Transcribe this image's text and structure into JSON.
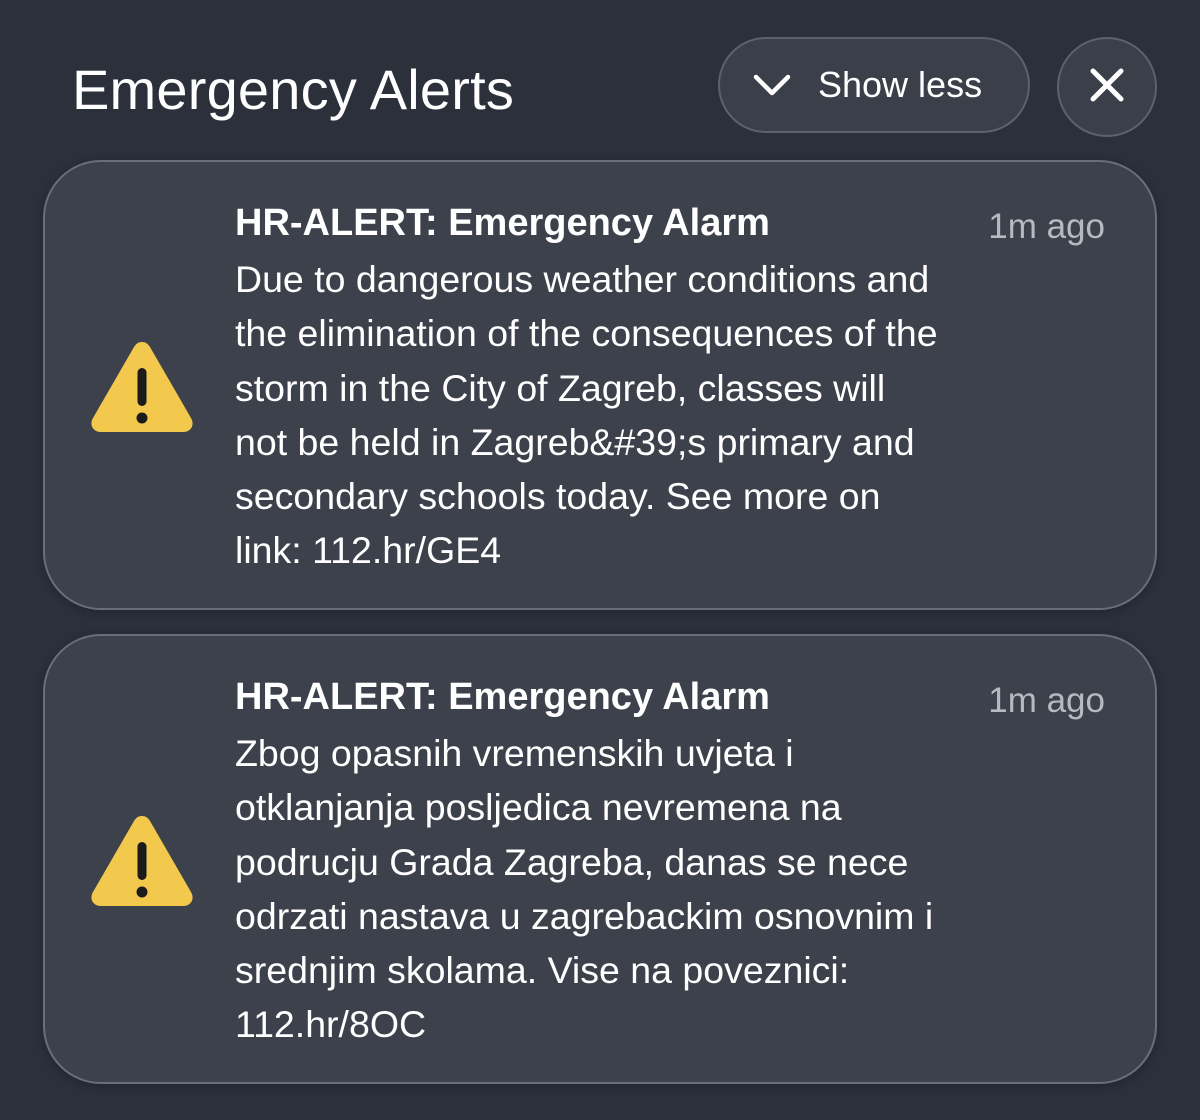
{
  "header": {
    "title": "Emergency Alerts",
    "show_less_label": "Show less",
    "show_less_icon": "chevron-down-icon",
    "close_icon": "close-icon"
  },
  "colors": {
    "background": "#2c303b",
    "card": "#3d414b",
    "warning_yellow": "#f2c94c",
    "timestamp": "#b7bac1"
  },
  "alerts": [
    {
      "icon": "warning-icon",
      "title": "HR-ALERT: Emergency Alarm",
      "time": "1m ago",
      "lines": [
        "Due to dangerous weather conditions and",
        "the elimination of the consequences of the",
        "storm in the City of Zagreb, classes will",
        "not be held in Zagreb&#39;s primary and",
        "secondary schools today. See more on",
        "link: 112.hr/GE4"
      ]
    },
    {
      "icon": "warning-icon",
      "title": "HR-ALERT: Emergency Alarm",
      "time": "1m ago",
      "lines": [
        "Zbog opasnih vremenskih uvjeta i",
        "otklanjanja posljedica nevremena na",
        "podrucju Grada Zagreba, danas se nece",
        "odrzati nastava u zagrebackim osnovnim i",
        "srednjim skolama. Vise na poveznici:",
        "112.hr/8OC"
      ]
    }
  ]
}
